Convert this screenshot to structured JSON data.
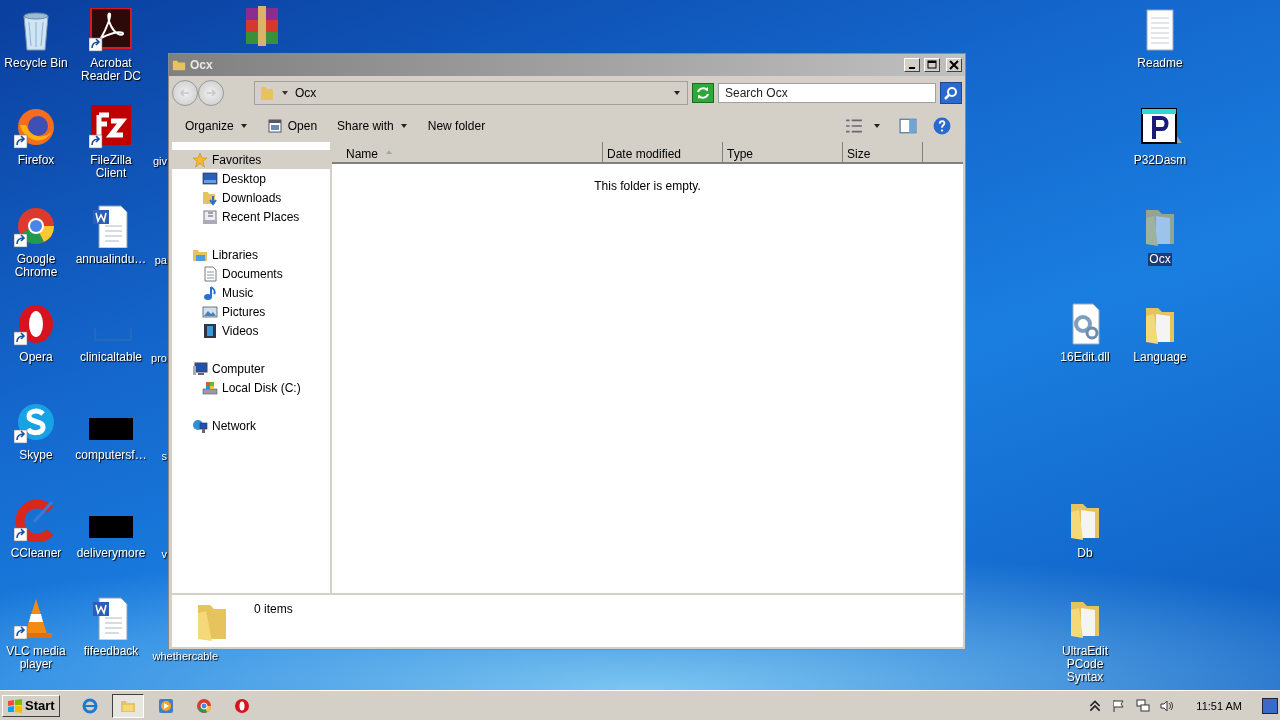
{
  "desktop": {
    "icons": [
      {
        "label": "Recycle Bin",
        "kind": "recycle",
        "shortcut": false,
        "selected": false
      },
      {
        "label": "Firefox",
        "kind": "firefox",
        "shortcut": true,
        "selected": false
      },
      {
        "label": "Google Chrome",
        "kind": "chrome",
        "shortcut": true,
        "selected": false
      },
      {
        "label": "Opera",
        "kind": "opera",
        "shortcut": true,
        "selected": false
      },
      {
        "label": "Skype",
        "kind": "skype",
        "shortcut": true,
        "selected": false
      },
      {
        "label": "CCleaner",
        "kind": "ccleaner",
        "shortcut": true,
        "selected": false
      },
      {
        "label": "VLC media player",
        "kind": "vlc",
        "shortcut": true,
        "selected": false
      },
      {
        "label": "Acrobat Reader DC",
        "kind": "acrobat",
        "shortcut": true,
        "selected": false
      },
      {
        "label": "FileZilla Client",
        "kind": "filezilla",
        "shortcut": true,
        "selected": false
      },
      {
        "label": "annualindu…",
        "kind": "word",
        "shortcut": false,
        "selected": false
      },
      {
        "label": "clinicaltable",
        "kind": "blank",
        "shortcut": false,
        "selected": false
      },
      {
        "label": "computersf…",
        "kind": "black",
        "shortcut": false,
        "selected": false
      },
      {
        "label": "deliverymore",
        "kind": "black",
        "shortcut": false,
        "selected": false
      },
      {
        "label": "fifeedback",
        "kind": "word",
        "shortcut": false,
        "selected": false
      },
      {
        "kind": "winrar",
        "shortcut": false,
        "selected": false
      },
      {
        "label": "giv",
        "kind": "hidden"
      },
      {
        "label": "pa",
        "kind": "hidden"
      },
      {
        "label": "pro",
        "kind": "hidden"
      },
      {
        "label": "s",
        "kind": "hidden"
      },
      {
        "label": "v",
        "kind": "hidden"
      },
      {
        "label": "whethercable",
        "kind": "hidden"
      },
      {
        "label": "Readme",
        "kind": "text",
        "shortcut": false,
        "selected": false
      },
      {
        "label": "P32Dasm",
        "kind": "p32",
        "shortcut": false,
        "selected": false
      },
      {
        "label": "Ocx",
        "kind": "folder",
        "shortcut": false,
        "selected": true
      },
      {
        "label": "16Edit.dll",
        "kind": "dll",
        "shortcut": false,
        "selected": false
      },
      {
        "label": "Language",
        "kind": "folder",
        "shortcut": false,
        "selected": false
      },
      {
        "label": "Db",
        "kind": "folder",
        "shortcut": false,
        "selected": false
      },
      {
        "label": "UltraEdit PCode Syntax",
        "kind": "folder",
        "shortcut": false,
        "selected": false
      }
    ]
  },
  "window": {
    "title": "Ocx",
    "address": "Ocx",
    "search": {
      "placeholder": "Search Ocx"
    },
    "toolbar": [
      {
        "label": "Organize",
        "kind": "menu"
      },
      {
        "label": "Open",
        "kind": "open"
      },
      {
        "label": "Share with",
        "kind": "menu"
      },
      {
        "label": "New folder",
        "kind": "plain"
      }
    ],
    "nav": [
      {
        "label": "Favorites",
        "kind": "star",
        "selected": true,
        "children": [
          {
            "label": "Desktop",
            "kind": "desktop",
            "selected": false
          },
          {
            "label": "Downloads",
            "kind": "downloads",
            "selected": false
          },
          {
            "label": "Recent Places",
            "kind": "recent",
            "selected": false
          }
        ]
      },
      {
        "label": "Libraries",
        "kind": "library",
        "selected": false,
        "children": [
          {
            "label": "Documents",
            "kind": "documents",
            "selected": false
          },
          {
            "label": "Music",
            "kind": "music",
            "selected": false
          },
          {
            "label": "Pictures",
            "kind": "pictures",
            "selected": false
          },
          {
            "label": "Videos",
            "kind": "videos",
            "selected": false
          }
        ]
      },
      {
        "label": "Computer",
        "kind": "computer",
        "selected": false,
        "children": [
          {
            "label": "Local Disk (C:)",
            "kind": "disk",
            "selected": false
          }
        ]
      },
      {
        "label": "Network",
        "kind": "network",
        "selected": false
      }
    ],
    "columns": [
      {
        "label": "Name",
        "sorted": true
      },
      {
        "label": "Date modified",
        "sorted": false
      },
      {
        "label": "Type",
        "sorted": false
      },
      {
        "label": "Size",
        "sorted": false
      }
    ],
    "empty_message": "This folder is empty.",
    "details": "0 items"
  },
  "taskbar": {
    "start": "Start",
    "apps": [
      {
        "kind": "ie",
        "active": false
      },
      {
        "kind": "explorer",
        "active": true
      },
      {
        "kind": "media",
        "active": false
      },
      {
        "kind": "chrome",
        "active": false
      },
      {
        "kind": "opera",
        "active": false
      }
    ],
    "clock": "11:51 AM"
  }
}
